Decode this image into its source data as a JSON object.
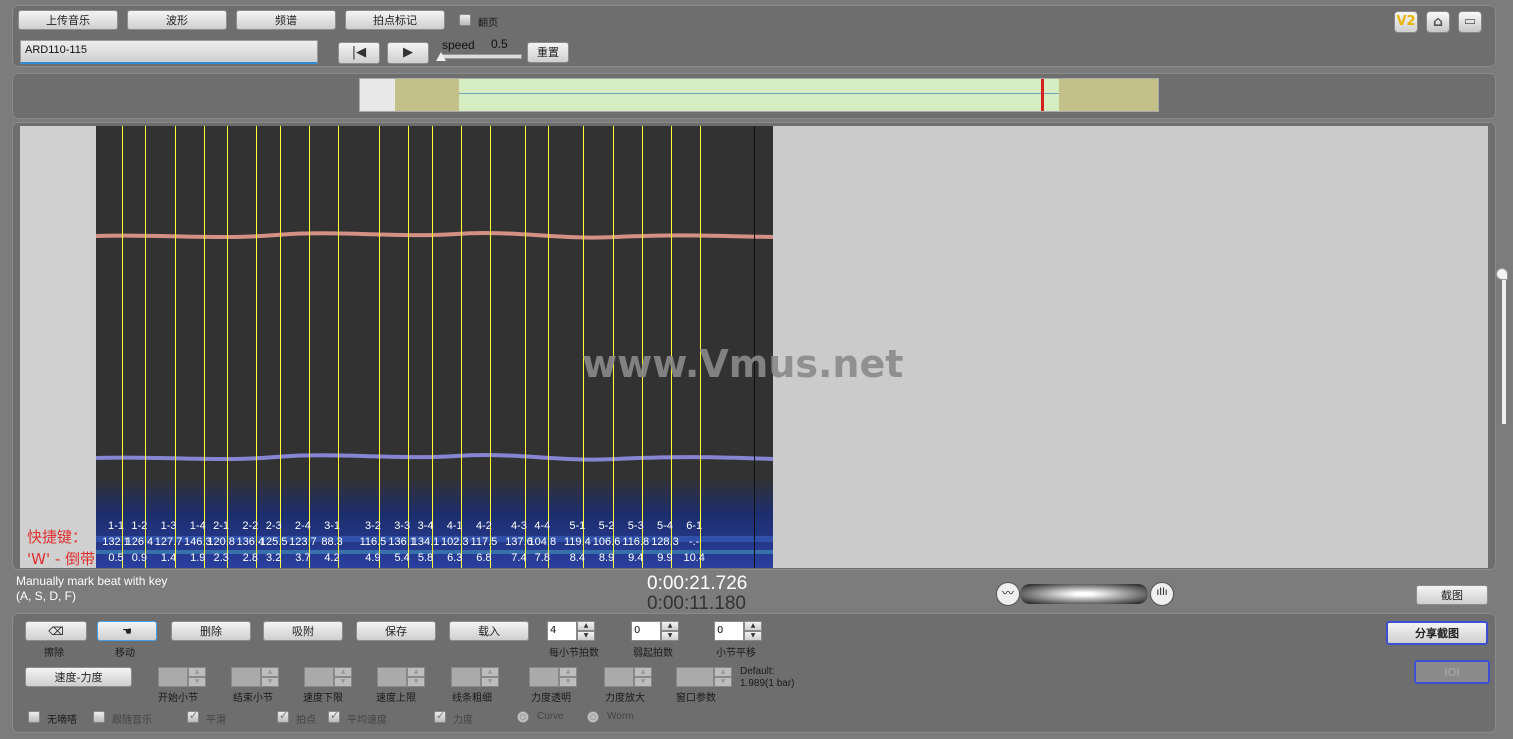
{
  "toolbar": {
    "upload": "上传音乐",
    "waveform": "波形",
    "spectrum": "频谱",
    "beat_mark": "拍点标记",
    "page_turn": "翻页",
    "file_name": "ARD110-115",
    "speed_label": "speed",
    "speed_value": "0.5",
    "reset": "重置",
    "v2": "V2"
  },
  "overview": {
    "playhead_fraction": 0.857
  },
  "canvas": {
    "watermark": "www.Vmus.net",
    "shortcut_line1": "快捷键：",
    "shortcut_line2": "'W' - 倒带"
  },
  "beats": [
    {
      "label": "1-1",
      "bpm": "132.1",
      "time": "0.5"
    },
    {
      "label": "1-2",
      "bpm": "126.4",
      "time": "0.9"
    },
    {
      "label": "1-3",
      "bpm": "127.7",
      "time": "1.4"
    },
    {
      "label": "1-4",
      "bpm": "146.3",
      "time": "1.9"
    },
    {
      "label": "2-1",
      "bpm": "120.8",
      "time": "2.3"
    },
    {
      "label": "2-2",
      "bpm": "136.4",
      "time": "2.8"
    },
    {
      "label": "2-3",
      "bpm": "125.5",
      "time": "3.2"
    },
    {
      "label": "2-4",
      "bpm": "123.7",
      "time": "3.7"
    },
    {
      "label": "3-1",
      "bpm": "88.3",
      "time": "4.2"
    },
    {
      "label": "3-2",
      "bpm": "116.5",
      "time": "4.9"
    },
    {
      "label": "3-3",
      "bpm": "136.1",
      "time": "5.4"
    },
    {
      "label": "3-4",
      "bpm": "134.1",
      "time": "5.8"
    },
    {
      "label": "4-1",
      "bpm": "102.3",
      "time": "6.3"
    },
    {
      "label": "4-2",
      "bpm": "117.5",
      "time": "6.8"
    },
    {
      "label": "4-3",
      "bpm": "137.6",
      "time": "7.4"
    },
    {
      "label": "4-4",
      "bpm": "104.8",
      "time": "7.8"
    },
    {
      "label": "5-1",
      "bpm": "119.4",
      "time": "8.4"
    },
    {
      "label": "5-2",
      "bpm": "106.6",
      "time": "8.9"
    },
    {
      "label": "5-3",
      "bpm": "116.8",
      "time": "9.4"
    },
    {
      "label": "5-4",
      "bpm": "128.3",
      "time": "9.9"
    },
    {
      "label": "6-1",
      "bpm": "-.-",
      "time": "10.4"
    }
  ],
  "status": {
    "manual_hint1": "Manually mark beat with key",
    "manual_hint2": "(A, S, D, F)",
    "time_total": "0:00:21.726",
    "time_current": "0:00:11.180",
    "screenshot": "截图"
  },
  "bottom": {
    "erase": "擦除",
    "move": "移动",
    "delete": "删除",
    "snap": "吸附",
    "save": "保存",
    "load": "载入",
    "beats_per_bar_value": "4",
    "beats_per_bar_label": "每小节拍数",
    "pickup_value": "0",
    "pickup_label": "弱起拍数",
    "bar_shift_value": "0",
    "bar_shift_label": "小节平移",
    "share": "分享截图",
    "ioi": "IOI",
    "tempo_dynamics": "速度-力度",
    "start_bar": "开始小节",
    "end_bar": "结束小节",
    "tempo_min": "速度下限",
    "tempo_max": "速度上限",
    "line_width": "线条粗细",
    "dyn_transparency": "力度透明",
    "dyn_scale": "力度放大",
    "window_param": "窗口参数",
    "default_line1": "Default:",
    "default_line2": "1.989(1 bar)",
    "metronome": "无嘀嗒",
    "follow_music": "跟随音乐",
    "smooth": "平滑",
    "beat_point": "拍点",
    "avg_tempo": "平均速度",
    "dynamics": "力度",
    "curve": "Curve",
    "worm": "Worm"
  }
}
